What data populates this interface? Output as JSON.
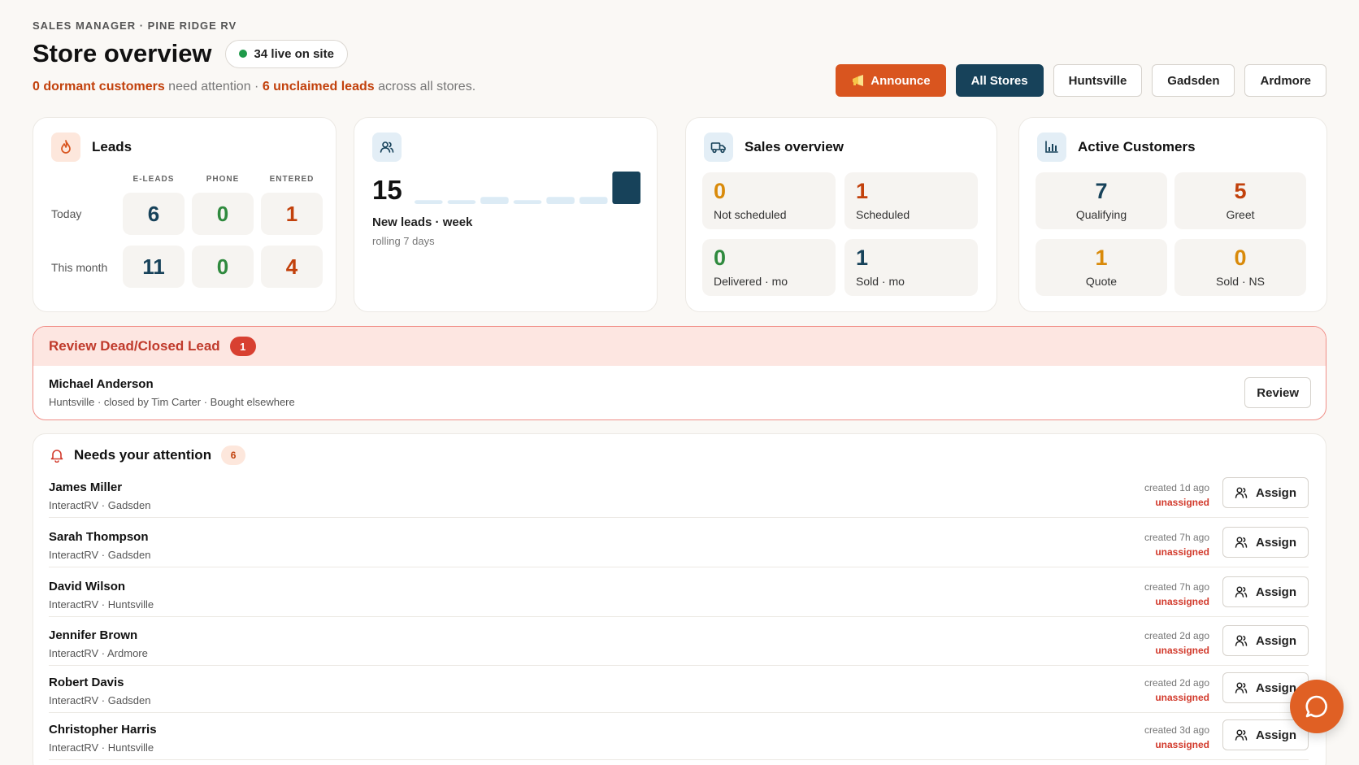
{
  "header": {
    "eyebrow": "SALES MANAGER · PINE RIDGE RV",
    "title": "Store overview",
    "live_label": "34 live on site",
    "dormant_text": "0 dormant customers",
    "dormant_suffix": " need attention · ",
    "unclaimed_text": "6 unclaimed leads",
    "unclaimed_suffix": " across all stores."
  },
  "toolbar": {
    "announce_label": "Announce",
    "stores": [
      "All Stores",
      "Huntsville",
      "Gadsden",
      "Ardmore"
    ],
    "active_store": "All Stores"
  },
  "leads_card": {
    "title": "Leads",
    "columns": [
      "E-LEADS",
      "PHONE",
      "ENTERED"
    ],
    "rows": [
      {
        "label": "Today",
        "values": [
          "6",
          "0",
          "1"
        ]
      },
      {
        "label": "This month",
        "values": [
          "11",
          "0",
          "4"
        ]
      }
    ]
  },
  "new_leads_card": {
    "value": "15",
    "label": "New leads · week",
    "sub": "rolling 7 days",
    "spark_relative": [
      0.12,
      0.12,
      0.22,
      0.12,
      0.22,
      0.22,
      1.0
    ]
  },
  "sales_card": {
    "title": "Sales overview",
    "tiles": [
      {
        "value": "0",
        "label": "Not scheduled"
      },
      {
        "value": "1",
        "label": "Scheduled"
      },
      {
        "value": "0",
        "label": "Delivered · mo"
      },
      {
        "value": "1",
        "label": "Sold · mo"
      }
    ]
  },
  "customers_card": {
    "title": "Active Customers",
    "tiles": [
      {
        "value": "7",
        "label": "Qualifying"
      },
      {
        "value": "5",
        "label": "Greet"
      },
      {
        "value": "1",
        "label": "Quote"
      },
      {
        "value": "0",
        "label": "Sold · NS"
      }
    ]
  },
  "review": {
    "title": "Review Dead/Closed Lead",
    "count": "1",
    "name": "Michael Anderson",
    "meta": "Huntsville · closed by Tim Carter · Bought elsewhere",
    "button": "Review"
  },
  "attention": {
    "title": "Needs your attention",
    "count": "6",
    "assign_label": "Assign",
    "items": [
      {
        "name": "James Miller",
        "meta": "InteractRV · Gadsden",
        "created": "created 1d ago",
        "status": "unassigned"
      },
      {
        "name": "Sarah Thompson",
        "meta": "InteractRV · Gadsden",
        "created": "created 7h ago",
        "status": "unassigned"
      },
      {
        "name": "David Wilson",
        "meta": "InteractRV · Huntsville",
        "created": "created 7h ago",
        "status": "unassigned"
      },
      {
        "name": "Jennifer Brown",
        "meta": "InteractRV · Ardmore",
        "created": "created 2d ago",
        "status": "unassigned"
      },
      {
        "name": "Robert Davis",
        "meta": "InteractRV · Gadsden",
        "created": "created 2d ago",
        "status": "unassigned"
      },
      {
        "name": "Christopher Harris",
        "meta": "InteractRV · Huntsville",
        "created": "created 3d ago",
        "status": "unassigned"
      }
    ]
  },
  "colors": {
    "accent": "#d9551f",
    "navy": "#17425a",
    "danger": "#d23a2c",
    "success": "#2f8a3e"
  },
  "icons": [
    "flame-icon",
    "users-icon",
    "truck-icon",
    "bar-chart-icon",
    "bell-icon",
    "user-plus-icon",
    "chat-icon",
    "megaphone-icon"
  ]
}
